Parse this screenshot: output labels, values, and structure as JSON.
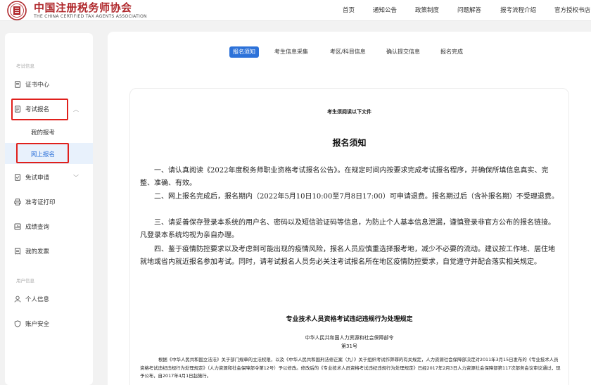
{
  "header": {
    "brand_cn": "中国注册税务师协会",
    "brand_en": "THE CHINA CERTIFIED TAX AGENTS ASSOCIATION",
    "nav": [
      "首页",
      "通知公告",
      "政策制度",
      "问题解答",
      "报考流程介绍",
      "官方授权书店"
    ]
  },
  "sidebar": {
    "section1_title": "考试信息",
    "section2_title": "用户信息",
    "items": {
      "cert_center": "证书中心",
      "exam_register": "考试报名",
      "my_registration": "我的报考",
      "online_register": "网上报名",
      "exemption": "免试申请",
      "admission_print": "准考证打印",
      "score_query": "成绩查询",
      "my_invoice": "我的发票",
      "personal_info": "个人信息",
      "account_security": "账户安全"
    }
  },
  "tabs": [
    "报名须知",
    "考生信息采集",
    "考区/科目信息",
    "确认提交信息",
    "报名完成"
  ],
  "document": {
    "subtitle": "考生须阅读以下文件",
    "title": "报名须知",
    "paragraphs": [
      "一、请认真阅读《2022年度税务师职业资格考试报名公告》。在规定时间内按要求完成考试报名程序，并确保所填信息真实、完整、准确、有效。",
      "二、网上报名完成后，报名期内（2022年5月10日10:00至7月8日17:00）可申请退费。报名期过后（含补报名期）不受理退费。",
      "三、请妥善保存登录本系统的用户名、密码以及短信验证码等信息，为防止个人基本信息泄漏，谨慎登录非官方公布的报名链接。凡登录本系统均视为亲自办理。",
      "四、鉴于疫情防控要求以及考虑到可能出现的疫情风险，报名人员应慎重选择报考地，减少不必要的流动。建议按工作地、居住地就地或省内就近报名参加考试。同时，请考试报名人员务必关注考试报名所在地区疫情防控要求，自觉遵守并配合落实相关规定。"
    ],
    "rule_title": "专业技术人员资格考试违纪违规行为处理规定",
    "rule_org": "中华人民共和国人力资源和社会保障部令",
    "rule_no": "第31号",
    "rule_body": "根据《中华人民共和国立法法》关于部门规章的立法权限，以及《中华人民共和国刑法修正案（九）》关于组织考试作弊罪的有关规定，人力资源社会保障部决定对2011年3月15日发布的《专业技术人员资格考试违纪违规行为处理规定》（人力资源和社会保障部令第12号）予以修改。修改后的《专业技术人员资格考试违纪违规行为处理规定》已经2017年2月3日人力资源社会保障部第117次部务会议审议通过，现予公布，自2017年4月1日起施行。"
  },
  "colors": {
    "brand": "#b0282c",
    "accent": "#2d72d9",
    "highlight_box": "#e0201c",
    "active_bg": "#e8f1fc"
  }
}
